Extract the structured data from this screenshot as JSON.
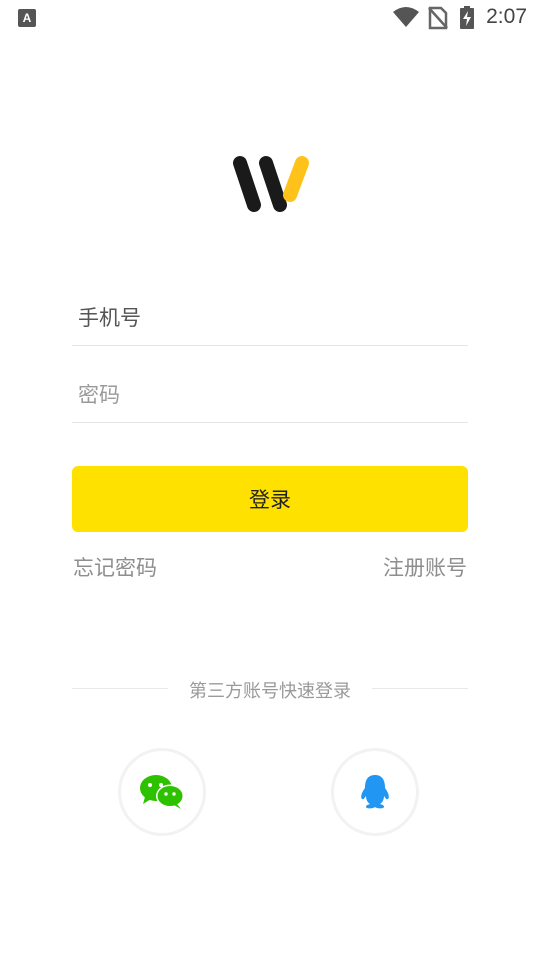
{
  "status_bar": {
    "time": "2:07"
  },
  "login": {
    "phone_placeholder": "手机号",
    "password_placeholder": "密码",
    "login_button": "登录",
    "forgot_password": "忘记密码",
    "register": "注册账号",
    "third_party_label": "第三方账号快速登录"
  },
  "social": [
    {
      "icon": "wechat-icon",
      "color": "#2dc100"
    },
    {
      "icon": "qq-icon",
      "color": "#2196f3"
    }
  ],
  "colors": {
    "accent": "#ffe100",
    "logo_dark": "#1a1a1a",
    "logo_yellow": "#ffc21a"
  }
}
